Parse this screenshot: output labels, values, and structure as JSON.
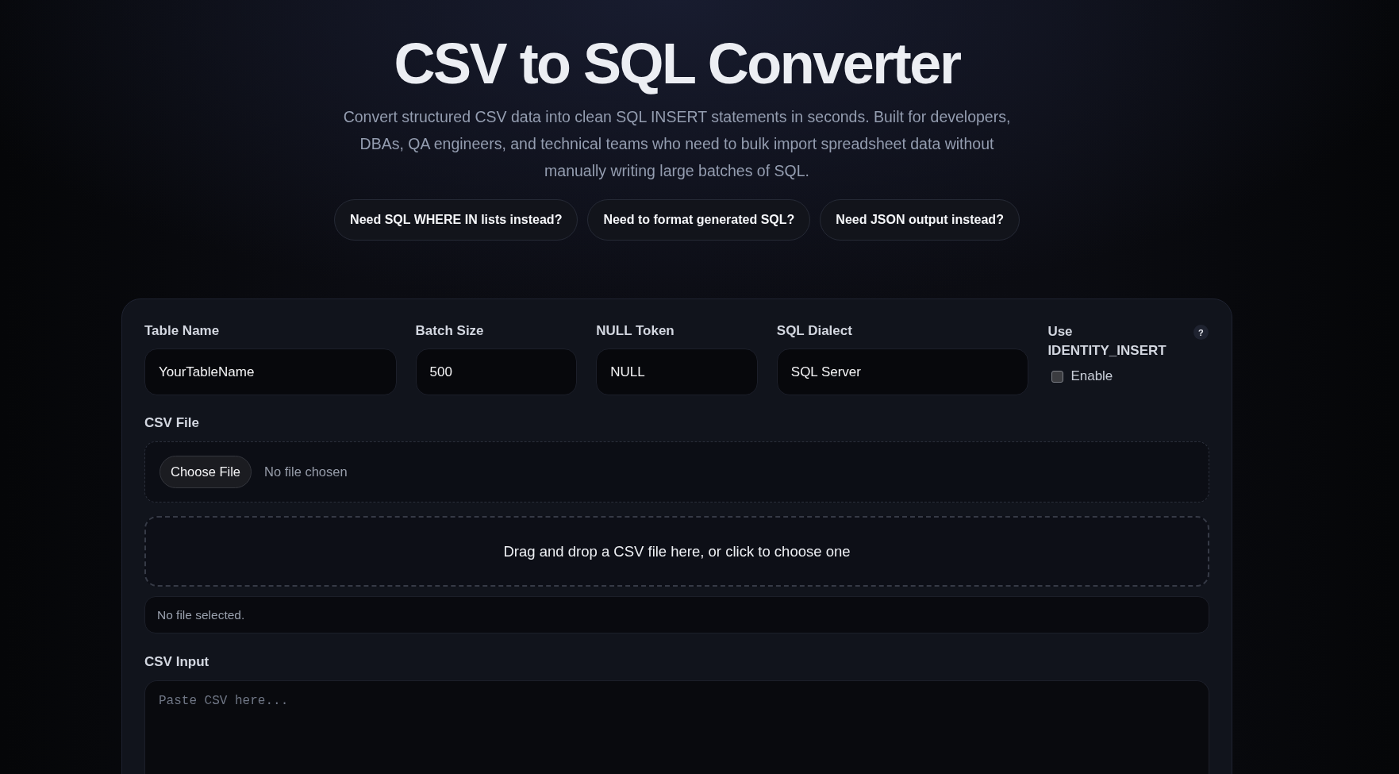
{
  "header": {
    "title": "CSV to SQL Converter",
    "description": "Convert structured CSV data into clean SQL INSERT statements in seconds. Built for developers, DBAs, QA engineers, and technical teams who need to bulk import spreadsheet data without manually writing large batches of SQL.",
    "links": [
      "Need SQL WHERE IN lists instead?",
      "Need to format generated SQL?",
      "Need JSON output instead?"
    ]
  },
  "settings": {
    "fields": [
      {
        "label": "Table Name",
        "value": "YourTableName"
      },
      {
        "label": "Batch Size",
        "value": "500"
      },
      {
        "label": "NULL Token",
        "value": "NULL"
      },
      {
        "label": "SQL Dialect",
        "value": "SQL Server"
      }
    ],
    "identity_insert": {
      "label": "Use IDENTITY_INSERT",
      "help": "?",
      "option": "Enable",
      "checked": false
    }
  },
  "csv_file": {
    "label": "CSV File",
    "button": "Choose File",
    "file_name": "No file chosen",
    "drop_zone": "Drag and drop a CSV file here, or click to choose one",
    "status": "No file selected."
  },
  "csv_input": {
    "label": "CSV Input",
    "placeholder": "Paste CSV here..."
  }
}
